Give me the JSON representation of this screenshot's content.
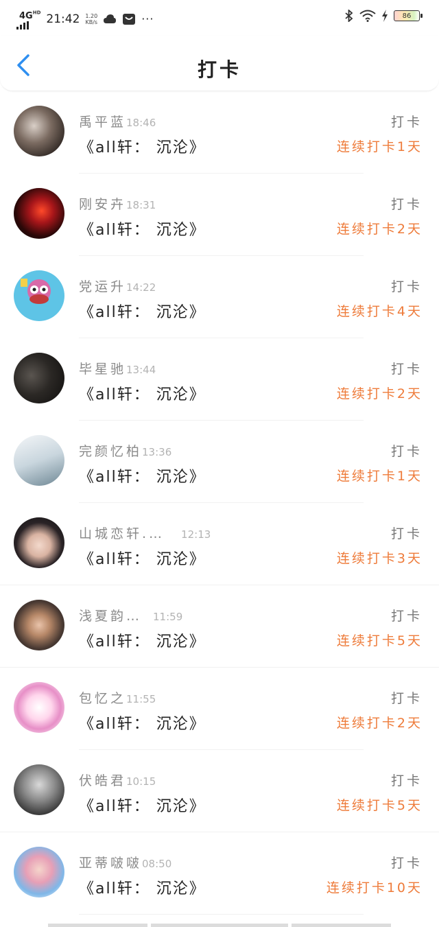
{
  "status_bar": {
    "network": "4G",
    "network_sup": "HD",
    "time": "21:42",
    "speed_value": "1.20",
    "speed_unit": "KB/s",
    "more": "···",
    "battery": "86"
  },
  "header": {
    "back_icon": "chevron-left-icon",
    "title": "打卡",
    "accent_color": "#2f8ff0"
  },
  "colors": {
    "streak": "#ee7b3a",
    "name": "#8a8a8a",
    "time": "#b3b3b3"
  },
  "items": [
    {
      "name": "禹平蓝",
      "time": "18:46",
      "title": "《all轩：  沉沦》",
      "action": "打卡",
      "streak": "连续打卡1天"
    },
    {
      "name": "刚安卉",
      "time": "18:31",
      "title": "《all轩：  沉沦》",
      "action": "打卡",
      "streak": "连续打卡2天"
    },
    {
      "name": "党运升",
      "time": "14:22",
      "title": "《all轩：  沉沦》",
      "action": "打卡",
      "streak": "连续打卡4天"
    },
    {
      "name": "毕星驰",
      "time": "13:44",
      "title": "《all轩：  沉沦》",
      "action": "打卡",
      "streak": "连续打卡2天"
    },
    {
      "name": "完颜忆柏",
      "time": "13:36",
      "title": "《all轩：  沉沦》",
      "action": "打卡",
      "streak": "连续打卡1天"
    },
    {
      "name": "山城恋轩.…",
      "time": "12:13",
      "title": "《all轩：  沉沦》",
      "action": "打卡",
      "streak": "连续打卡3天"
    },
    {
      "name": "浅夏韵…",
      "time": "11:59",
      "title": "《all轩：  沉沦》",
      "action": "打卡",
      "streak": "连续打卡5天"
    },
    {
      "name": "包忆之",
      "time": "11:55",
      "title": "《all轩：  沉沦》",
      "action": "打卡",
      "streak": "连续打卡2天"
    },
    {
      "name": "伏皓君",
      "time": "10:15",
      "title": "《all轩：  沉沦》",
      "action": "打卡",
      "streak": "连续打卡5天"
    },
    {
      "name": "亚蒂啵啵",
      "time": "08:50",
      "title": "《all轩：  沉沦》",
      "action": "打卡",
      "streak": "连续打卡10天"
    }
  ]
}
